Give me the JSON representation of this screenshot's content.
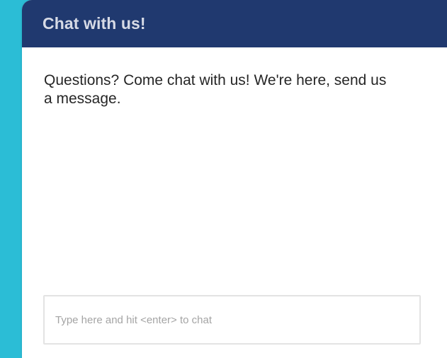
{
  "widget": {
    "header": {
      "title": "Chat with us!"
    },
    "welcome_message": "Questions? Come chat with us! We're here, send us a message.",
    "input": {
      "placeholder": "Type here and hit <enter> to chat",
      "value": ""
    }
  },
  "colors": {
    "page_background": "#2bbdd6",
    "header_background": "#20396f",
    "header_text": "#d7dbe6",
    "panel_background": "#ffffff",
    "input_border": "#e3e3e3"
  }
}
